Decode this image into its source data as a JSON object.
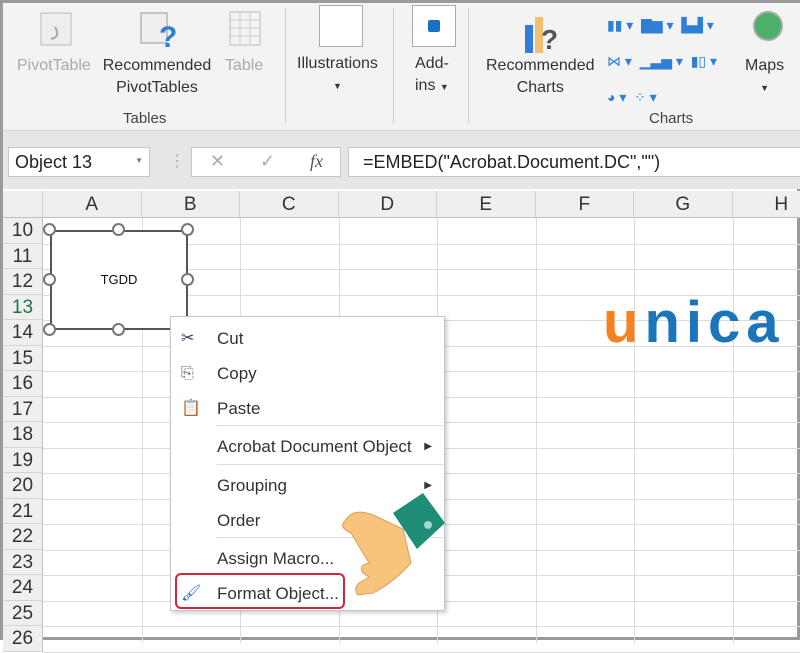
{
  "ribbon": {
    "tables": {
      "pivottable": "PivotTable",
      "recommended_pivot_1": "Recommended",
      "recommended_pivot_2": "PivotTables",
      "table": "Table",
      "group_label": "Tables"
    },
    "illustrations": "Illustrations",
    "addins_1": "Add-",
    "addins_2": "ins",
    "charts": {
      "recommended_1": "Recommended",
      "recommended_2": "Charts",
      "maps": "Maps",
      "group_label": "Charts"
    }
  },
  "formula_bar": {
    "name_box": "Object 13",
    "cancel": "✕",
    "enter": "✓",
    "fx": "fx",
    "formula": "=EMBED(\"Acrobat.Document.DC\",\"\")"
  },
  "columns": [
    "A",
    "B",
    "C",
    "D",
    "E",
    "F",
    "G",
    "H"
  ],
  "rows": [
    "10",
    "11",
    "12",
    "13",
    "14",
    "15",
    "16",
    "17",
    "18",
    "19",
    "20",
    "21",
    "22",
    "23",
    "24",
    "25",
    "26"
  ],
  "object": {
    "label": "TGDD"
  },
  "context_menu": [
    {
      "label": "Cut",
      "icon": "scissors-icon"
    },
    {
      "label": "Copy",
      "icon": "copy-icon"
    },
    {
      "label": "Paste",
      "icon": "paste-icon"
    },
    {
      "label": "Acrobat Document Object",
      "submenu": true
    },
    {
      "label": "Grouping",
      "submenu": true
    },
    {
      "label": "Order"
    },
    {
      "label": "Assign Macro..."
    },
    {
      "label": "Format Object...",
      "icon": "format-object-icon",
      "highlighted": true
    }
  ],
  "logo": {
    "text": "unica",
    "colors": {
      "u": "#f5821f",
      "rest": "#1a75bb"
    }
  }
}
